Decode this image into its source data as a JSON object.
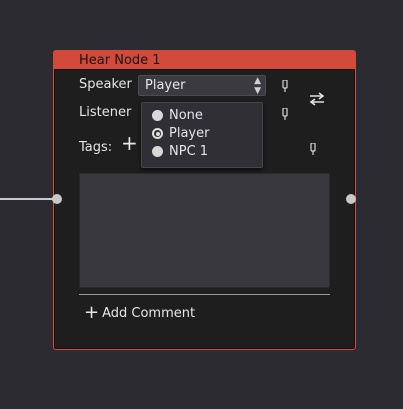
{
  "node": {
    "title": "Hear Node 1",
    "accent_color": "#d24a3a"
  },
  "fields": {
    "speaker_label": "Speaker",
    "speaker_value": "Player",
    "listener_label": "Listener",
    "tags_label": "Tags:"
  },
  "dropdown": {
    "options": [
      {
        "label": "None",
        "checked": false
      },
      {
        "label": "Player",
        "checked": true
      },
      {
        "label": "NPC 1",
        "checked": false
      }
    ]
  },
  "actions": {
    "add_comment_label": "Add Comment",
    "add_tag_icon": "plus-icon",
    "swap_icon": "swap-arrows-icon",
    "pin_icon": "pin-icon"
  }
}
